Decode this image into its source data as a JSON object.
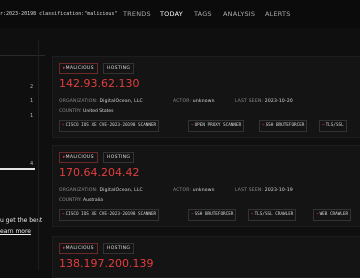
{
  "search": {
    "query": "r:2023-20198 classification:\"malicious\""
  },
  "nav": {
    "trends": "TRENDS",
    "today": "TODAY",
    "tags": "TAGS",
    "analysis": "ANALYSIS",
    "alerts": "ALERTS"
  },
  "sidebar": {
    "counts": [
      "2",
      "1",
      "1",
      "4"
    ],
    "promo": {
      "text": "u get the best",
      "link": "earn more"
    }
  },
  "results": [
    {
      "tags": [
        "MALICIOUS",
        "HOSTING"
      ],
      "ip": "142.93.62.130",
      "organization_label": "ORGANIZATION:",
      "organization": "DigitalOcean, LLC",
      "actor_label": "ACTOR:",
      "actor": "unknown",
      "last_seen_label": "LAST SEEN:",
      "last_seen": "2023-10-20",
      "country_label": "COUNTRY:",
      "country": "United States",
      "chips": [
        "CISCO IOS XE CVE-2023-20198 SCANNER",
        "OPEN PROXY SCANNER",
        "SSH BRUTEFORCER",
        "TLS/SSL"
      ]
    },
    {
      "tags": [
        "MALICIOUS",
        "HOSTING"
      ],
      "ip": "170.64.204.42",
      "organization_label": "ORGANIZATION:",
      "organization": "DigitalOcean, LLC",
      "actor_label": "ACTOR:",
      "actor": "unknown",
      "last_seen_label": "LAST SEEN:",
      "last_seen": "2023-10-19",
      "country_label": "COUNTRY:",
      "country": "Australia",
      "chips": [
        "CISCO IOS XE CVE-2023-20198 SCANNER",
        "SSH BRUTEFORCER",
        "TLS/SSL CRAWLER",
        "WEB CRAWLER"
      ]
    },
    {
      "tags": [
        "MALICIOUS",
        "HOSTING"
      ],
      "ip": "138.197.200.139"
    }
  ],
  "colors": {
    "accent_red": "#e43d3d",
    "background": "#0f0f0f"
  }
}
